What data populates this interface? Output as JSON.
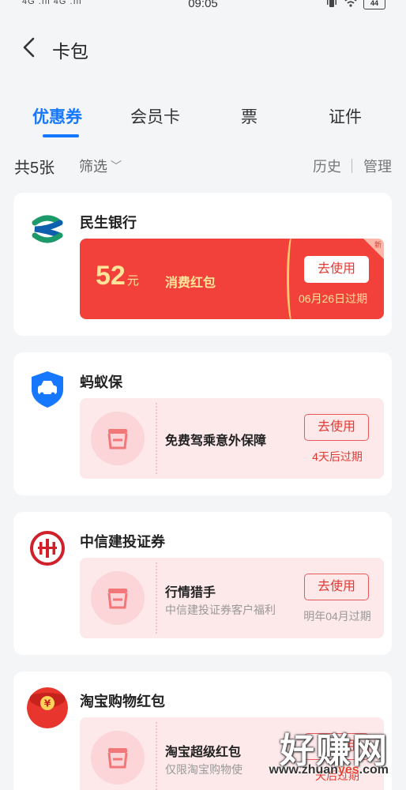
{
  "status_bar": {
    "time": "09:05",
    "signal": "4G .ıll 4G .ıll",
    "battery": "44"
  },
  "header": {
    "title": "卡包"
  },
  "tabs": [
    {
      "label": "优惠券"
    },
    {
      "label": "会员卡"
    },
    {
      "label": "票"
    },
    {
      "label": "证件"
    }
  ],
  "toolbar": {
    "count": "共5张",
    "filter": "筛选",
    "history": "历史",
    "manage": "管理"
  },
  "cards": [
    {
      "merchant": "民生银行",
      "logo_icon": "minsheng-bank-logo",
      "coupon": {
        "amount": "52",
        "unit": "元",
        "type": "消费红包",
        "button": "去使用",
        "expiry": "06月26日过期",
        "tag": "新"
      }
    },
    {
      "merchant": "蚂蚁保",
      "logo_icon": "car-shield-logo",
      "coupon": {
        "title": "免费驾乘意外保障",
        "subtitle": "",
        "button": "去使用",
        "expiry": "4天后过期"
      }
    },
    {
      "merchant": "中信建投证券",
      "logo_icon": "citic-logo",
      "coupon": {
        "title": "行情猎手",
        "subtitle": "中信建投证券客户福利",
        "button": "去使用",
        "expiry": "明年04月过期"
      }
    },
    {
      "merchant": "淘宝购物红包",
      "logo_icon": "red-envelope-logo",
      "coupon": {
        "title": "淘宝超级红包",
        "subtitle": "仅限淘宝购物使",
        "button": "去使用",
        "expiry": "天后过期"
      }
    }
  ],
  "watermark": {
    "big": "好赚网",
    "small_prefix": "www.zhuan",
    "small_accent": "yes",
    "small_suffix": ".com"
  },
  "colors": {
    "accent": "#1677ff",
    "coupon_red": "#f2413b",
    "coupon_gold": "#ffe49a",
    "coupon_pink": "#fde9ea"
  }
}
